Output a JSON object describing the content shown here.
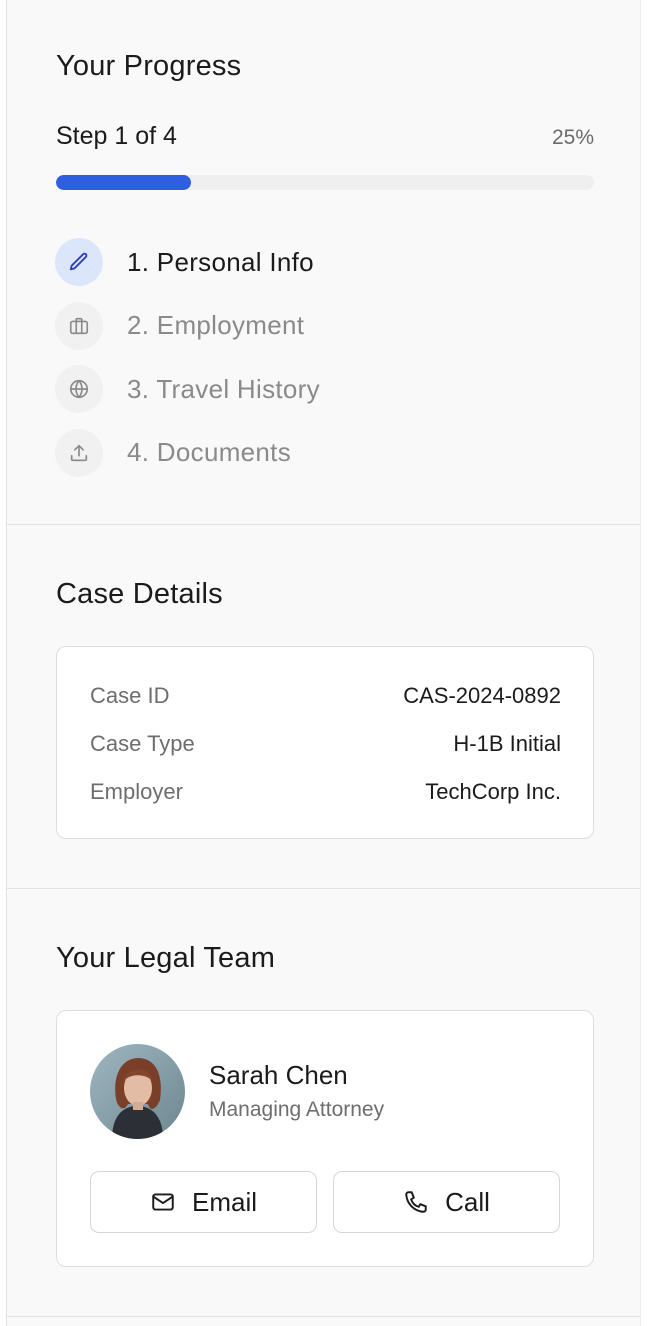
{
  "progress": {
    "title": "Your Progress",
    "step_text": "Step 1 of 4",
    "percent_text": "25%",
    "percent_value": 0.25,
    "accent_color": "#2f5fe0",
    "steps": [
      {
        "label": "1. Personal Info",
        "icon": "pencil-icon",
        "active": true
      },
      {
        "label": "2. Employment",
        "icon": "briefcase-icon",
        "active": false
      },
      {
        "label": "3. Travel History",
        "icon": "globe-icon",
        "active": false
      },
      {
        "label": "4. Documents",
        "icon": "upload-icon",
        "active": false
      }
    ]
  },
  "case_details": {
    "title": "Case Details",
    "rows": [
      {
        "key": "Case ID",
        "value": "CAS-2024-0892"
      },
      {
        "key": "Case Type",
        "value": "H-1B Initial"
      },
      {
        "key": "Employer",
        "value": "TechCorp Inc."
      }
    ]
  },
  "legal_team": {
    "title": "Your Legal Team",
    "member": {
      "name": "Sarah Chen",
      "role": "Managing Attorney",
      "avatar_icon": "attorney-photo"
    },
    "email_label": "Email",
    "call_label": "Call"
  }
}
